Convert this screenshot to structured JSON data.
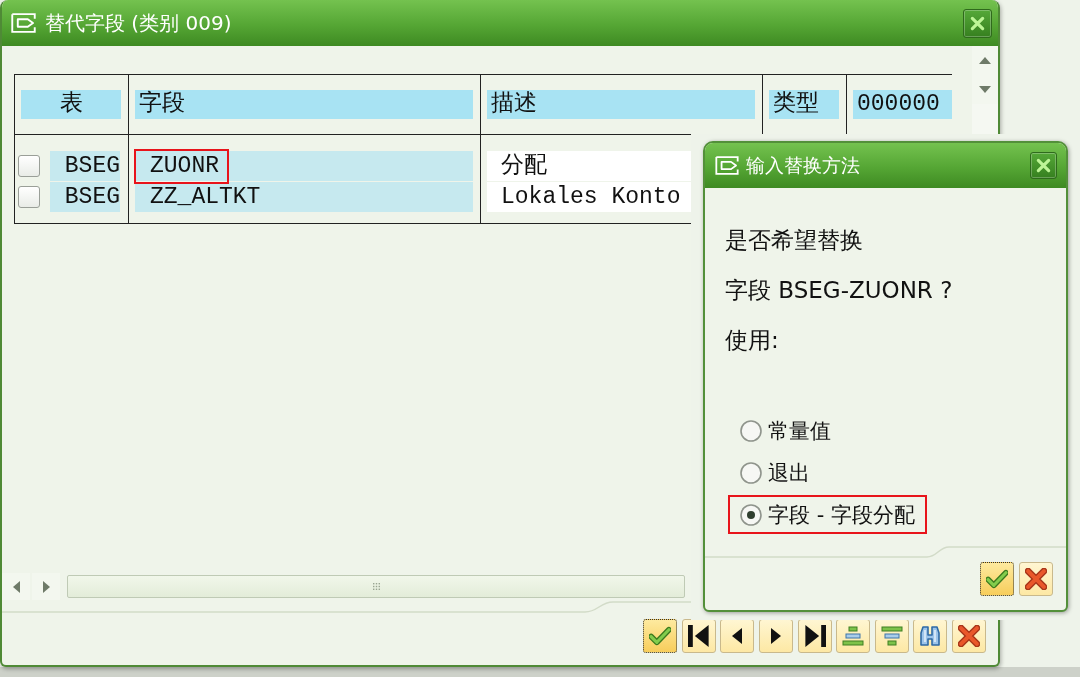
{
  "window": {
    "title": "替代字段 (类别 009)"
  },
  "table": {
    "columns": [
      "表",
      "字段",
      "描述",
      "类型",
      "000000"
    ],
    "rows": [
      {
        "checked": false,
        "table": "BSEG",
        "field": "ZUONR",
        "field_highlighted": true,
        "description": "分配"
      },
      {
        "checked": false,
        "table": "BSEG",
        "field": "ZZ_ALTKT",
        "field_highlighted": false,
        "description": "Lokales Konto"
      }
    ]
  },
  "toolbar": [
    {
      "kind": "confirm",
      "focused": true
    },
    {
      "kind": "first",
      "focused": false
    },
    {
      "kind": "previous",
      "focused": false
    },
    {
      "kind": "next",
      "focused": false
    },
    {
      "kind": "last",
      "focused": false
    },
    {
      "kind": "sort_ascending",
      "focused": false
    },
    {
      "kind": "sort_descending",
      "focused": false
    },
    {
      "kind": "find",
      "focused": false
    },
    {
      "kind": "cancel",
      "focused": false
    }
  ],
  "dialog": {
    "title": "输入替换方法",
    "lines": [
      "是否希望替换",
      "字段 BSEG-ZUONR ?",
      "使用:"
    ],
    "options": [
      {
        "label": "常量值",
        "selected": false,
        "highlighted": false
      },
      {
        "label": "退出",
        "selected": false,
        "highlighted": false
      },
      {
        "label": "字段 - 字段分配",
        "selected": true,
        "highlighted": true
      }
    ],
    "buttons": [
      {
        "kind": "confirm",
        "focused": true
      },
      {
        "kind": "cancel",
        "focused": false
      }
    ]
  }
}
